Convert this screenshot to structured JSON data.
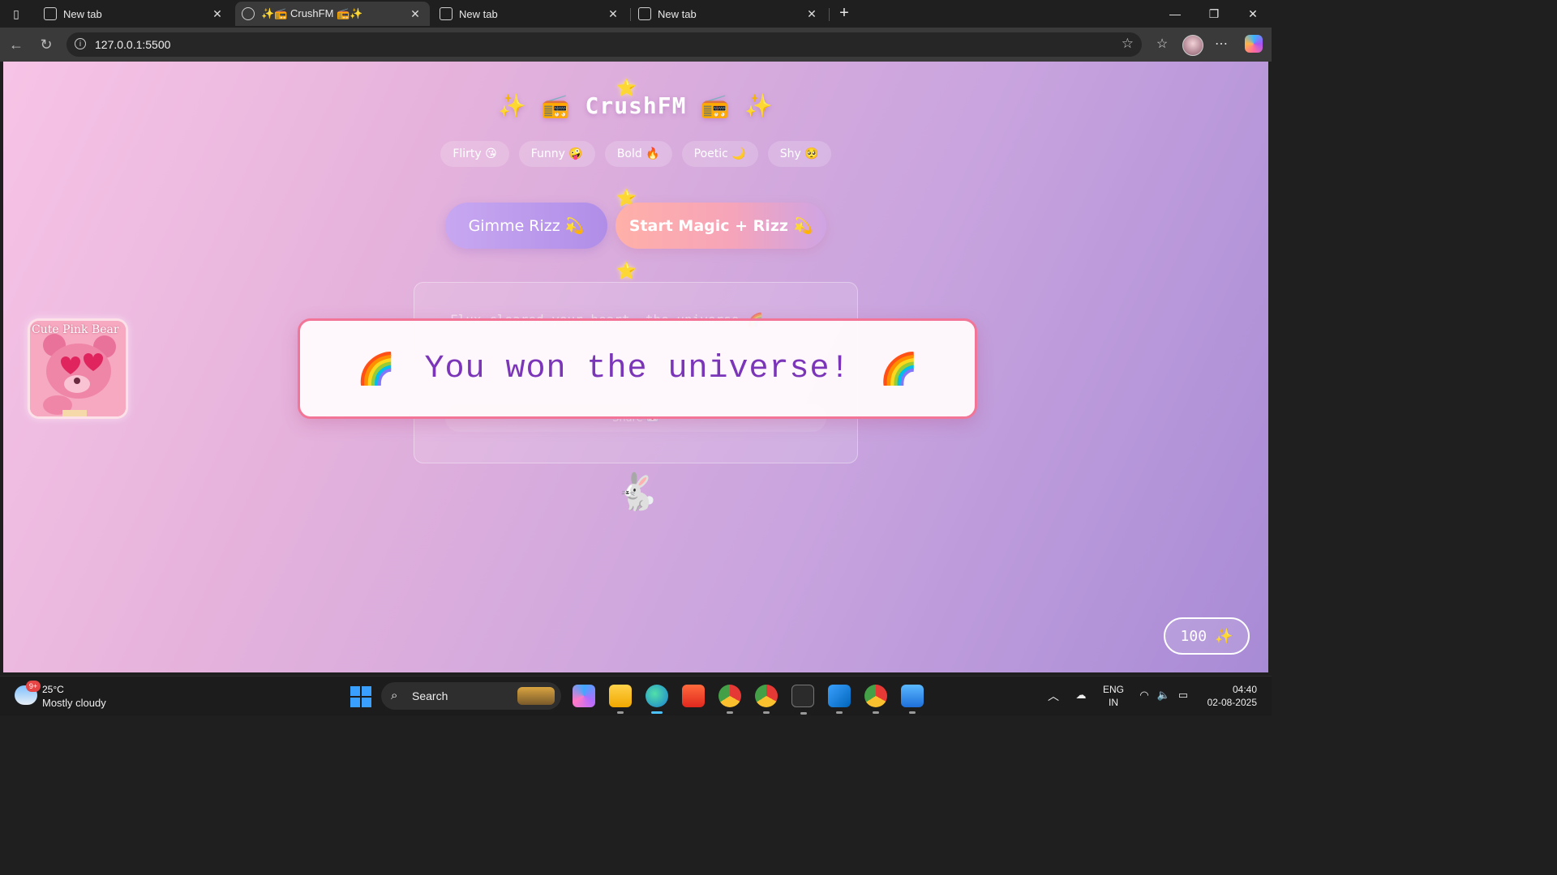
{
  "browser": {
    "tabs": [
      {
        "title": "New tab",
        "active": false,
        "icon": "new-tab-page-icon"
      },
      {
        "title": "✨📻 CrushFM 📻✨",
        "active": true,
        "icon": "globe-icon"
      },
      {
        "title": "New tab",
        "active": false,
        "icon": "new-tab-page-icon"
      },
      {
        "title": "New tab",
        "active": false,
        "icon": "new-tab-page-icon"
      }
    ],
    "address": "127.0.0.1:5500"
  },
  "page": {
    "title": "✨ 📻  CrushFM  📻 ✨",
    "moods": [
      "Flirty 😘",
      "Funny 🤪",
      "Bold 🔥",
      "Poetic 🌙",
      "Shy 🥺"
    ],
    "buttons": {
      "rizz": "Gimme Rizz 💫",
      "magic": "Start Magic + Rizz 💫"
    },
    "card": {
      "line": "Flux cleared your heart, the universe 🌈",
      "share": "Share 💌"
    },
    "bear_alt": "Cute Pink Bear",
    "toast": {
      "emoji": "🌈",
      "text": "You won the universe!"
    },
    "mascot": "🐇",
    "counter": {
      "value": "100",
      "icon": "✨"
    },
    "sparkle_glyph": "⭐"
  },
  "taskbar": {
    "weather": {
      "temp": "25°C",
      "desc": "Mostly cloudy",
      "badge": "9+"
    },
    "search_label": "Search",
    "lang": [
      "ENG",
      "IN"
    ],
    "time": "04:40",
    "date": "02-08-2025"
  },
  "colors": {
    "toast_border": "#f27496",
    "toast_text": "#7a35b8",
    "page_gradient_start": "#f7c4e6",
    "page_gradient_end": "#a88bd6"
  }
}
